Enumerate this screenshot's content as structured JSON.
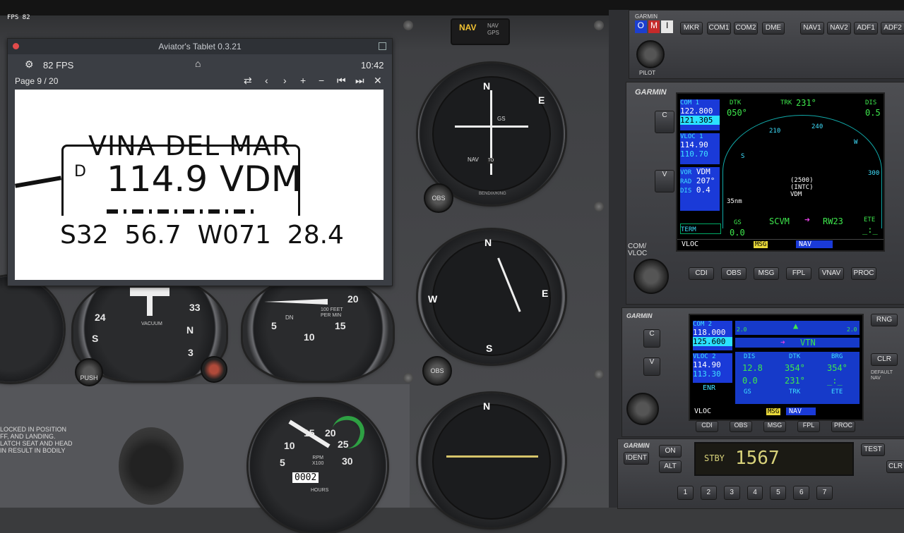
{
  "fps_overlay": "FPS 82",
  "annunciator": {
    "nav_label": "NAV",
    "nav_gps_label": "NAV\nGPS"
  },
  "tablet": {
    "title": "Aviator's Tablet  0.3.21",
    "fps": "82 FPS",
    "clock": "10:42",
    "page_indicator": "Page 9 / 20",
    "chart": {
      "station_name": "VINA DEL MAR",
      "dme_flag": "D",
      "frequency": "114.9",
      "ident": "VDM",
      "coordinates": "S32  56.7  W071  28.4"
    }
  },
  "gauges": {
    "obs_knob_1": "OBS",
    "obs_knob_2": "OBS",
    "push_knob": "PUSH",
    "vacuum_label": "VACUUM",
    "vsi_label": "100 FEET\nPER MIN",
    "vsi_dn": "DN",
    "rpm_label": "RPM\nX100",
    "hours_label": "HOURS",
    "hobbs": "0002",
    "bendix_label": "BENDIX/KING",
    "gs_label": "GS",
    "nav_label": "NAV",
    "to_label": "TO"
  },
  "gns530": {
    "brand": "GARMIN",
    "com1_label": "COM 1",
    "com1_active": "122.800",
    "com1_standby": "121.305",
    "vloc1_label": "VLOC 1",
    "vloc1_active": "114.90",
    "vloc1_standby": "110.70",
    "vor_ident_label": "VOR",
    "vor_ident": "VDM",
    "rad_label": "RAD",
    "rad_value": "207°",
    "dis_label": "DIS",
    "dis_value": "0.4",
    "term_label": "TERM",
    "dtk_label": "DTK",
    "dtk_value": "050°",
    "trk_label": "TRK",
    "trk_value": "231°",
    "dis_right_label": "DIS",
    "dis_right_value": "0.5",
    "gs_label": "GS",
    "gs_value": "0.0",
    "wp_from": "SCVM",
    "wp_to": "RW23",
    "ete_label": "ETE",
    "ete_value": "_:_",
    "range": "35nm",
    "map_labels": [
      "210",
      "240",
      "S",
      "W",
      "300"
    ],
    "map_waypoint": "(2500)\n(INTC)\nVDM",
    "status_vloc": "VLOC",
    "status_msg": "MSG",
    "status_nav": "NAV",
    "buttons": [
      "CDI",
      "OBS",
      "MSG",
      "FPL",
      "VNAV",
      "PROC"
    ],
    "com_vloc_label": "COM/\nVLOC",
    "push_cv": "PUSH\nC/V"
  },
  "gns430": {
    "brand": "GARMIN",
    "com2_label": "COM 2",
    "com2_active": "118.000",
    "com2_standby": "125.600",
    "vloc2_label": "VLOC 2",
    "vloc2_active": "114.90",
    "vloc2_standby": "113.30",
    "enr_label": "ENR",
    "dest": "VTN",
    "dis_label": "DIS",
    "dtk_label": "DTK",
    "brg_label": "BRG",
    "dis_value": "12.8",
    "dtk_value": "354°",
    "brg_value": "354°",
    "gs_value": "0.0",
    "trk_value": "231°",
    "ete_value": "_:_",
    "gs_label": "GS",
    "trk_label": "TRK",
    "ete_label": "ETE",
    "cdi_left": "2.0",
    "cdi_right": "2.0",
    "status_vloc": "VLOC",
    "status_msg": "MSG",
    "status_nav": "NAV",
    "buttons": [
      "CDI",
      "OBS",
      "MSG",
      "FPL",
      "PROC"
    ],
    "rng_label": "RNG",
    "clr_label": "CLR",
    "default_nav": "DEFAULT\nNAV"
  },
  "audio_panel": {
    "brand": "GARMIN",
    "markers": [
      "O",
      "M",
      "I"
    ],
    "buttons": [
      "MKR",
      "COM1",
      "COM2",
      "DME",
      "NAV1",
      "NAV2",
      "ADF1",
      "ADF2"
    ],
    "pilot_label": "PILOT"
  },
  "transponder": {
    "brand": "GARMIN",
    "mode": "STBY",
    "code": "1567",
    "ident_label": "IDENT",
    "on_label": "ON",
    "alt_label": "ALT",
    "test_label": "TEST",
    "clr_label": "CLR",
    "digits": [
      "1",
      "2",
      "3",
      "4",
      "5",
      "6",
      "7"
    ]
  },
  "placard": "LOCKED IN POSITION\nFF, AND LANDING.\nLATCH SEAT AND HEAD\nIN RESULT IN BODILY"
}
